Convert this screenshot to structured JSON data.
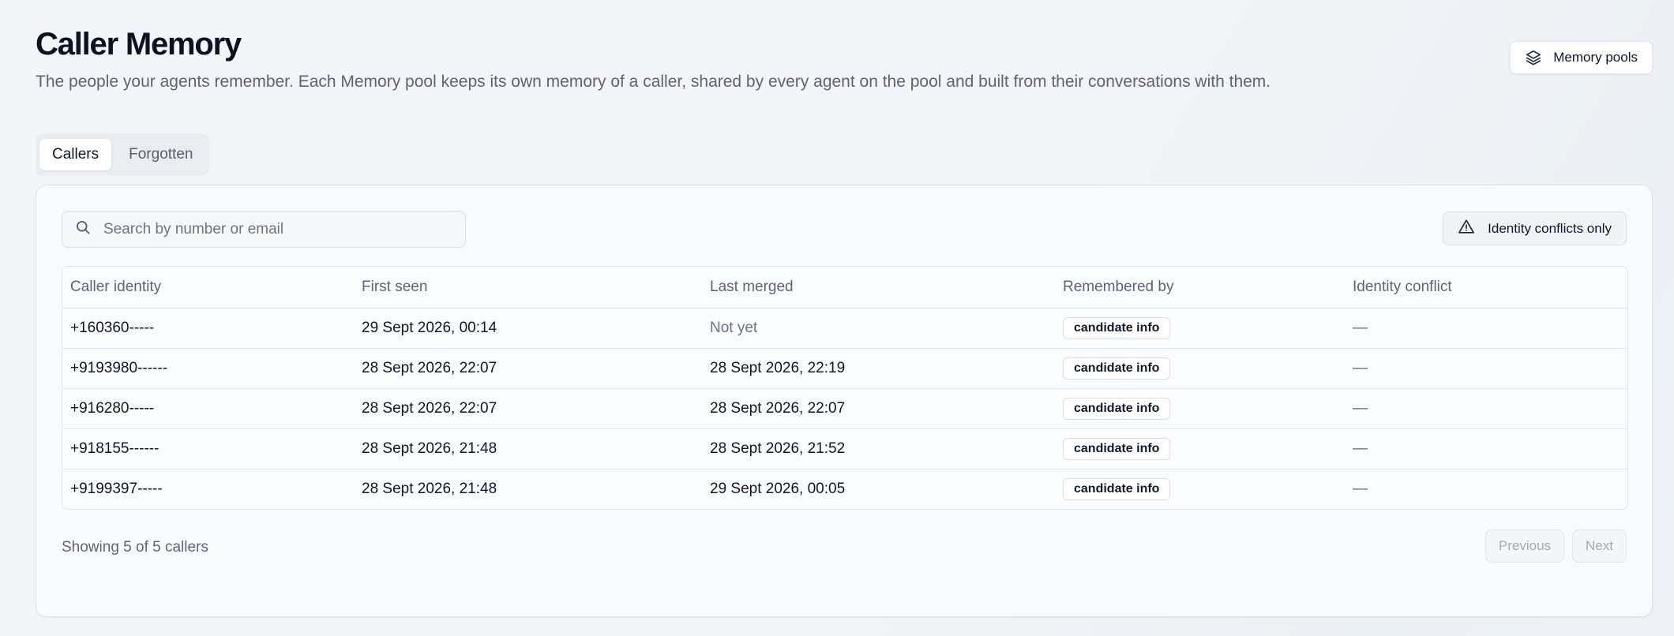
{
  "header": {
    "title": "Caller Memory",
    "subtitle": "The people your agents remember. Each Memory pool keeps its own memory of a caller, shared by every agent on the pool and built from their conversations with them.",
    "pools_button": "Memory pools"
  },
  "tabs": [
    {
      "label": "Callers",
      "active": true
    },
    {
      "label": "Forgotten",
      "active": false
    }
  ],
  "search": {
    "placeholder": "Search by number or email",
    "value": ""
  },
  "filter_button": "Identity conflicts only",
  "table": {
    "columns": [
      "Caller identity",
      "First seen",
      "Last merged",
      "Remembered by",
      "Identity conflict"
    ],
    "rows": [
      {
        "identity": "+160360-----",
        "first_seen": "29 Sept 2026, 00:14",
        "last_merged": "Not yet",
        "remembered_by": "candidate info",
        "conflict": "—"
      },
      {
        "identity": "+9193980------",
        "first_seen": "28 Sept 2026, 22:07",
        "last_merged": "28 Sept 2026, 22:19",
        "remembered_by": "candidate info",
        "conflict": "—"
      },
      {
        "identity": "+916280-----",
        "first_seen": "28 Sept 2026, 22:07",
        "last_merged": "28 Sept 2026, 22:07",
        "remembered_by": "candidate info",
        "conflict": "—"
      },
      {
        "identity": "+918155------",
        "first_seen": "28 Sept 2026, 21:48",
        "last_merged": "28 Sept 2026, 21:52",
        "remembered_by": "candidate info",
        "conflict": "—"
      },
      {
        "identity": "+9199397-----",
        "first_seen": "28 Sept 2026, 21:48",
        "last_merged": "29 Sept 2026, 00:05",
        "remembered_by": "candidate info",
        "conflict": "—"
      }
    ]
  },
  "footer": {
    "showing": "Showing 5 of 5 callers",
    "previous": "Previous",
    "next": "Next"
  },
  "icons": {
    "pools_button": "layers-icon",
    "search": "search-icon",
    "filter_button": "warning-triangle-icon"
  },
  "colors": {
    "text_primary": "#0f172a",
    "text_muted": "#5b6575",
    "border": "#dde2e8"
  }
}
